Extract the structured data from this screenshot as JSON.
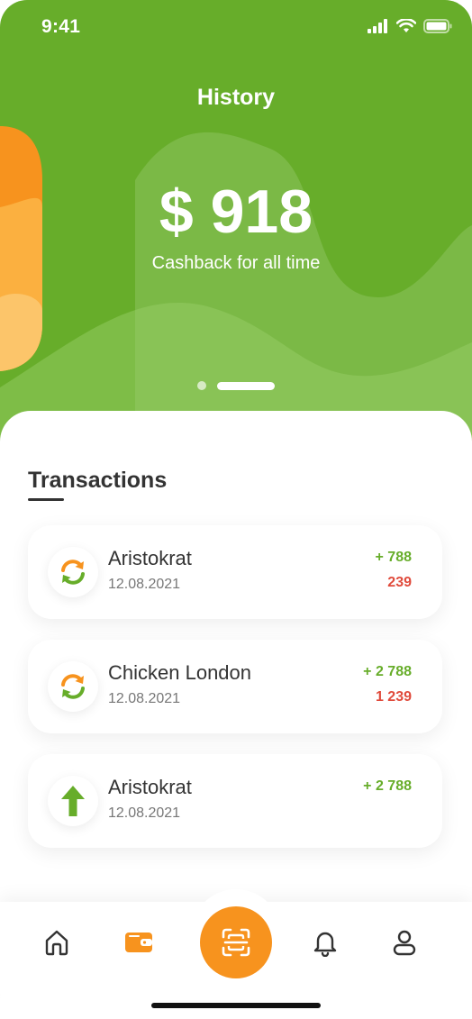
{
  "status_bar": {
    "time": "9:41"
  },
  "header": {
    "title": "History",
    "amount": "$ 918",
    "amount_caption": "Cashback for all time",
    "pager": {
      "pages": 2,
      "active_index": 1
    }
  },
  "transactions": {
    "title": "Transactions",
    "items": [
      {
        "name": "Aristokrat",
        "date": "12.08.2021",
        "plus": "+ 788",
        "minus": "239",
        "icon": "exchange-icon"
      },
      {
        "name": "Chicken London",
        "date": "12.08.2021",
        "plus": "+ 2 788",
        "minus": "1 239",
        "icon": "exchange-icon"
      },
      {
        "name": "Aristokrat",
        "date": "12.08.2021",
        "plus": "+ 2 788",
        "minus": "",
        "icon": "arrow-up-icon"
      }
    ]
  },
  "tabbar": {
    "items": [
      {
        "icon": "home-icon",
        "active": false
      },
      {
        "icon": "wallet-icon",
        "active": true
      },
      {
        "icon": "scan-icon",
        "active": false
      },
      {
        "icon": "bell-icon",
        "active": false
      },
      {
        "icon": "user-icon",
        "active": false
      }
    ]
  },
  "colors": {
    "brand_green": "#67ad2a",
    "accent_orange": "#f7931e",
    "negative_red": "#e04b3c",
    "text_dark": "#333333"
  }
}
